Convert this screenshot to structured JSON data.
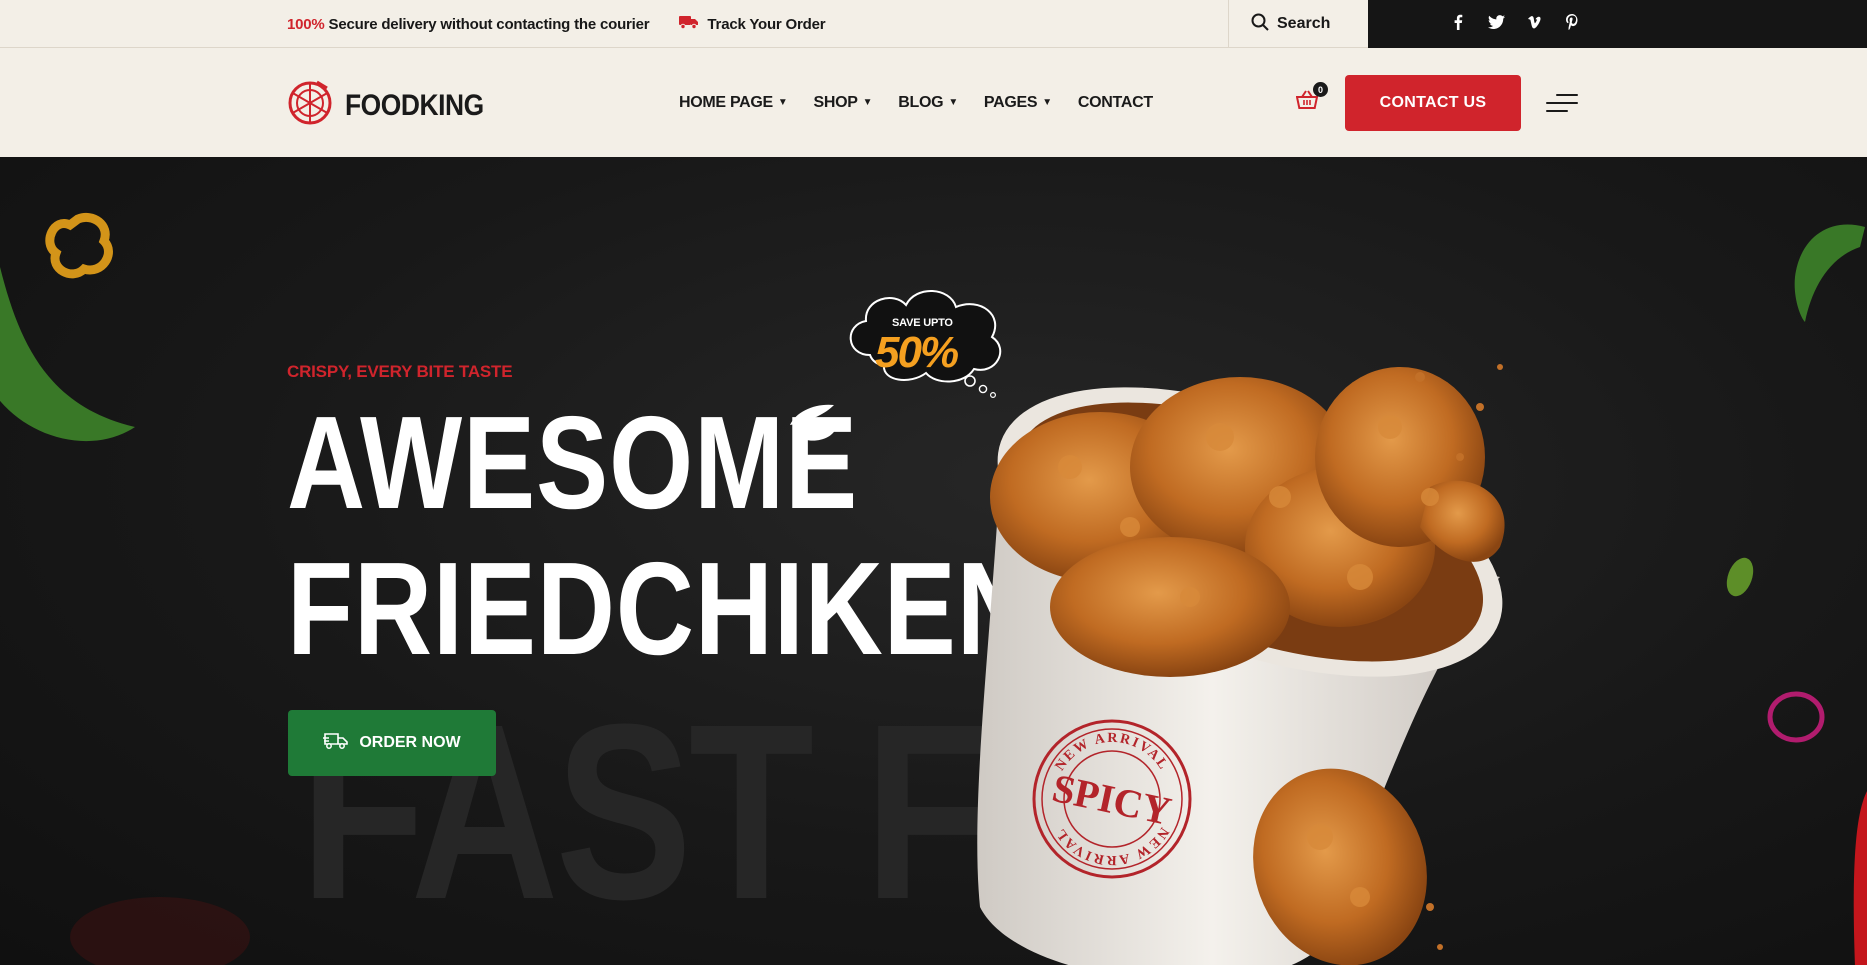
{
  "topbar": {
    "delivery_highlight": "100%",
    "delivery_text": " Secure delivery without contacting the courier",
    "track_label": "Track Your Order",
    "search_label": "Search",
    "social": [
      "f",
      "t",
      "v",
      "p"
    ]
  },
  "header": {
    "logo_text": "FOODKING",
    "nav": [
      {
        "label": "HOME PAGE",
        "dropdown": true
      },
      {
        "label": "SHOP",
        "dropdown": true
      },
      {
        "label": "BLOG",
        "dropdown": true
      },
      {
        "label": "PAGES",
        "dropdown": true
      },
      {
        "label": "CONTACT",
        "dropdown": false
      }
    ],
    "cart_count": "0",
    "contact_button": "CONTACT US"
  },
  "hero": {
    "eyebrow": "CRISPY, EVERY BITE TASTE",
    "title_line1": "AWESOME",
    "title_line2": "FRIEDCHIKEN",
    "order_button": "ORDER NOW",
    "watermark": "FAST FO",
    "promo_small": "SAVE UPTO",
    "promo_big": "50%",
    "stamp_top": "NEW ARRIVAL",
    "stamp_main": "SPICY",
    "stamp_bottom": "NEW ARRIVAL"
  },
  "colors": {
    "accent_red": "#d0242c",
    "order_green": "#1f7a37",
    "promo_orange": "#f5a020",
    "cream": "#f3efe7",
    "dark": "#151515"
  }
}
